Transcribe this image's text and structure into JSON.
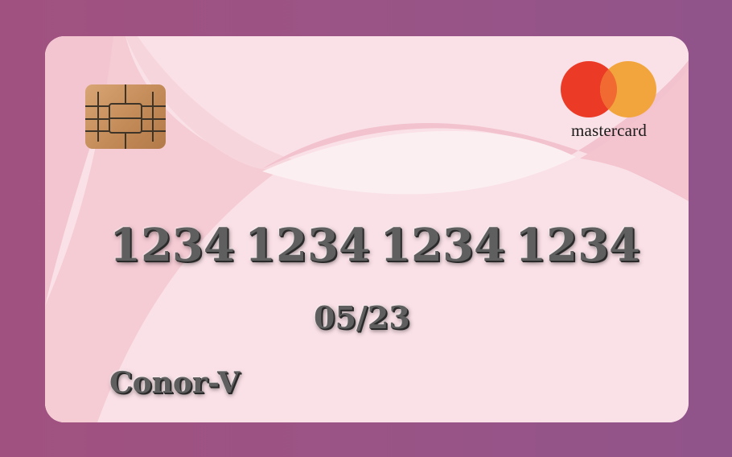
{
  "card": {
    "number_groups": [
      "1234",
      "1234",
      "1234",
      "1234"
    ],
    "expiry": "05/23",
    "holder_name": "Conor-V",
    "brand": "mastercard"
  },
  "icons": {
    "chip": "emv-chip-icon",
    "logo": "mastercard-logo-icon"
  },
  "colors": {
    "background": "#9a5486",
    "card_base": "#fae1e7",
    "logo_red": "#eb3a26",
    "logo_orange": "#f2a53c"
  }
}
